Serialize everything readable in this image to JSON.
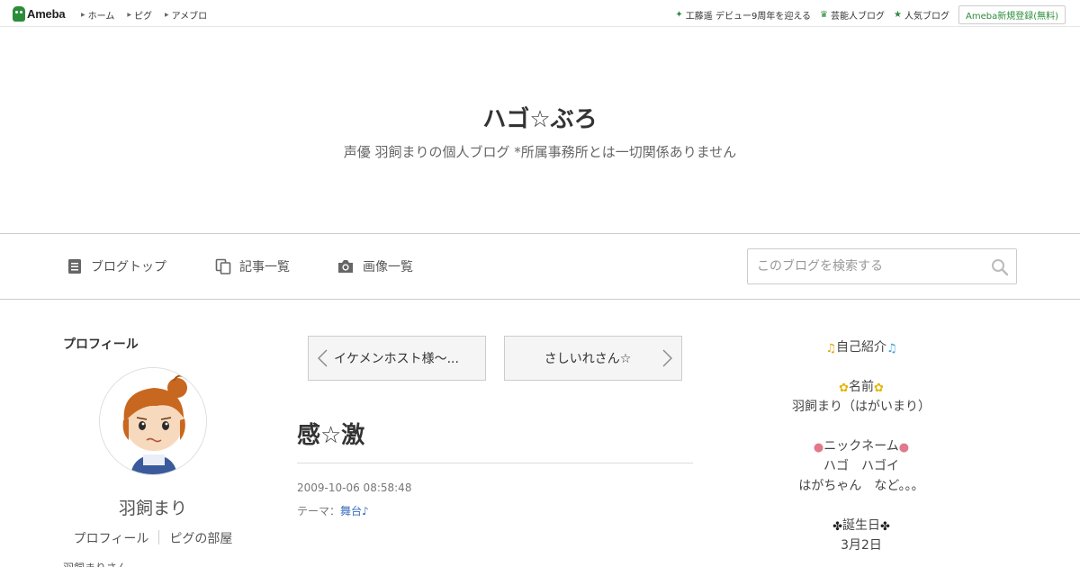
{
  "topbar": {
    "logo_text": "Ameba",
    "nav": [
      {
        "label": "ホーム"
      },
      {
        "label": "ピグ"
      },
      {
        "label": "アメブロ"
      }
    ],
    "right_links": [
      {
        "label": "工藤遥 デビュー9周年を迎える",
        "icon": "sparkle-icon"
      },
      {
        "label": "芸能人ブログ",
        "icon": "crown-icon"
      },
      {
        "label": "人気ブログ",
        "icon": "star-icon"
      }
    ],
    "register_label": "Ameba新規登録(無料)"
  },
  "blog": {
    "title": "ハゴ☆ぶろ",
    "description": "声優 羽飼まりの個人ブログ *所属事務所とは一切関係ありません"
  },
  "nav": {
    "items": [
      {
        "label": "ブログトップ",
        "icon": "document-icon"
      },
      {
        "label": "記事一覧",
        "icon": "copy-icon"
      },
      {
        "label": "画像一覧",
        "icon": "camera-icon"
      }
    ],
    "search_placeholder": "このブログを検索する"
  },
  "profile": {
    "heading": "プロフィール",
    "name": "羽飼まり",
    "links": [
      {
        "label": "プロフィール"
      },
      {
        "label": "ピグの部屋"
      }
    ],
    "cut_text": "羽飼まりさん"
  },
  "entry": {
    "prev_label": "イケメンホスト様～...",
    "next_label": "さしいれさん☆",
    "title": "感☆激",
    "date": "2009-10-06 08:58:48",
    "theme_prefix": "テーマ：",
    "theme": "舞台♪"
  },
  "right_sidebar": {
    "intro": "自己紹介",
    "name_heading": "名前",
    "name_value": "羽飼まり（はがいまり）",
    "nickname_heading": "ニックネーム",
    "nickname_line1": "ハゴ　ハゴイ",
    "nickname_line2": "はがちゃん　など。。。",
    "birthday_heading": "誕生日",
    "birthday_value": "3月2日"
  },
  "colors": {
    "brand_green": "#2d8c3c",
    "link_blue": "#3b6dbf"
  }
}
